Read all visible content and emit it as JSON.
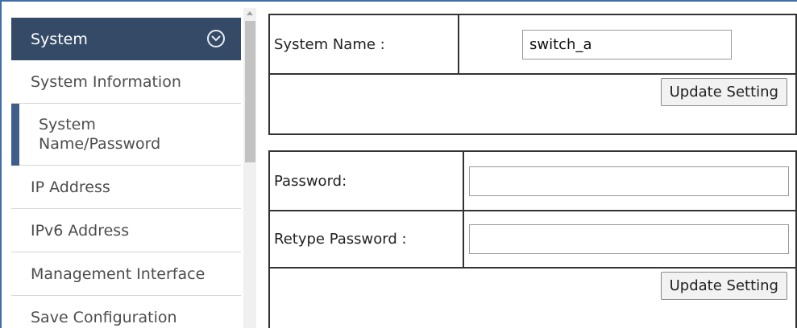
{
  "sidebar": {
    "header": "System",
    "items": [
      {
        "label": "System Information"
      },
      {
        "label": "System Name/Password",
        "line1": "System",
        "line2": "Name/Password"
      },
      {
        "label": "IP Address"
      },
      {
        "label": "IPv6 Address"
      },
      {
        "label": "Management Interface"
      },
      {
        "label": "Save Configuration"
      }
    ],
    "active_item": "System Name/Password"
  },
  "system_name_form": {
    "label": "System Name :",
    "value": "switch_a",
    "button": "Update Setting"
  },
  "password_form": {
    "password_label": "Password:",
    "password_value": "",
    "retype_label": "Retype Password :",
    "retype_value": "",
    "button": "Update Setting"
  },
  "colors": {
    "sidebar_header_bg": "#344a66",
    "active_indicator": "#3f5f8a",
    "frame_border": "#3f6ea8"
  }
}
